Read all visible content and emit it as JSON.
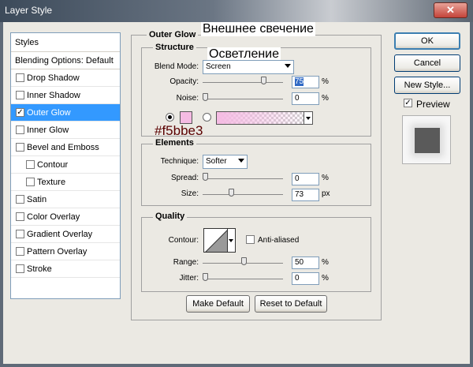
{
  "window": {
    "title": "Layer Style",
    "close_glyph": "✕"
  },
  "styles_list": {
    "header": "Styles",
    "blending": "Blending Options: Default",
    "items": [
      {
        "label": "Drop Shadow",
        "checked": false
      },
      {
        "label": "Inner Shadow",
        "checked": false
      },
      {
        "label": "Outer Glow",
        "checked": true
      },
      {
        "label": "Inner Glow",
        "checked": false
      },
      {
        "label": "Bevel and Emboss",
        "checked": false
      },
      {
        "label": "Contour",
        "checked": false
      },
      {
        "label": "Texture",
        "checked": false
      },
      {
        "label": "Satin",
        "checked": false
      },
      {
        "label": "Color Overlay",
        "checked": false
      },
      {
        "label": "Gradient Overlay",
        "checked": false
      },
      {
        "label": "Pattern Overlay",
        "checked": false
      },
      {
        "label": "Stroke",
        "checked": false
      }
    ]
  },
  "outer_glow": {
    "title": "Outer Glow",
    "overlay_title": "Внешнее свечение",
    "structure": {
      "title": "Structure",
      "overlay_blend": "Осветление",
      "blend_mode_label": "Blend Mode:",
      "blend_mode": "Screen",
      "opacity_label": "Opacity:",
      "opacity": "75",
      "noise_label": "Noise:",
      "noise": "0",
      "percent": "%",
      "color_hex": "#f5bbe3",
      "color_note": "#f5bbe3"
    },
    "elements": {
      "title": "Elements",
      "technique_label": "Technique:",
      "technique": "Softer",
      "spread_label": "Spread:",
      "spread": "0",
      "size_label": "Size:",
      "size": "73",
      "percent": "%",
      "px": "px"
    },
    "quality": {
      "title": "Quality",
      "contour_label": "Contour:",
      "anti_aliased": "Anti-aliased",
      "range_label": "Range:",
      "range": "50",
      "jitter_label": "Jitter:",
      "jitter": "0",
      "percent": "%"
    },
    "make_default": "Make Default",
    "reset_default": "Reset to Default"
  },
  "buttons": {
    "ok": "OK",
    "cancel": "Cancel",
    "new_style": "New Style..."
  },
  "preview": {
    "label": "Preview",
    "checked": true,
    "check_glyph": "✓"
  },
  "colors": {
    "selected_row": "#3399ff",
    "glow": "#f5bbe3",
    "window_bg": "#ebe9e3"
  }
}
